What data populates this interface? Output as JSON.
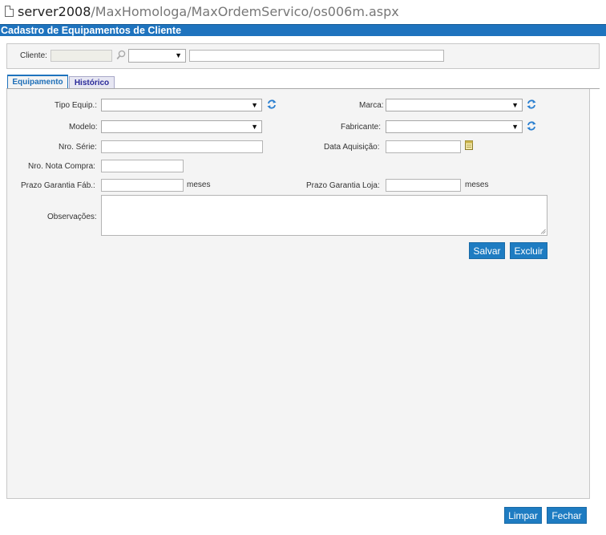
{
  "browser": {
    "url_host": "server2008",
    "url_path": "/MaxHomologa/MaxOrdemServico/os006m.aspx"
  },
  "page": {
    "title": "Cadastro de Equipamentos de Cliente"
  },
  "cliente": {
    "label": "Cliente:",
    "code_value": "",
    "select_value": "",
    "name_value": ""
  },
  "tabs": [
    {
      "label": "Equipamento",
      "active": true
    },
    {
      "label": "Histórico",
      "active": false
    }
  ],
  "form": {
    "tipo_equip_label": "Tipo Equip.:",
    "marca_label": "Marca:",
    "modelo_label": "Modelo:",
    "fabricante_label": "Fabricante:",
    "nro_serie_label": "Nro. Série:",
    "data_aquisicao_label": "Data Aquisição:",
    "nro_nota_compra_label": "Nro. Nota Compra:",
    "prazo_garantia_fab_label": "Prazo Garantia Fáb.:",
    "prazo_garantia_loja_label": "Prazo Garantia Loja:",
    "meses_unit": "meses",
    "observacoes_label": "Observações:"
  },
  "buttons": {
    "salvar": "Salvar",
    "excluir": "Excluir",
    "limpar": "Limpar",
    "fechar": "Fechar"
  },
  "icons": {
    "refresh": "refresh-icon",
    "search": "search-icon",
    "calendar": "calendar-icon",
    "page": "page-icon"
  },
  "colors": {
    "accent": "#1e73be",
    "button": "#1e7cc2",
    "panel_bg": "#f4f4f4"
  }
}
